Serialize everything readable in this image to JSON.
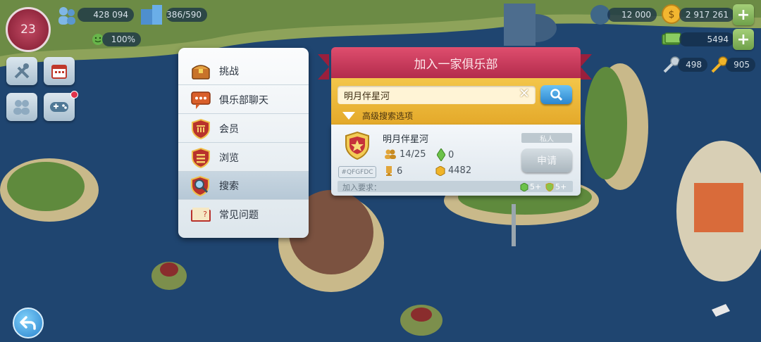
{
  "hud": {
    "level": "23",
    "population": "428 094",
    "capacity": "386/590",
    "happiness": "100%",
    "simoleons_small": "12 000",
    "simoleons": "2 917 261",
    "simcash": "5494",
    "keys_silver": "498",
    "keys_gold": "905"
  },
  "menu": {
    "items": [
      {
        "label": "挑战",
        "icon": "treasure-chest-icon"
      },
      {
        "label": "俱乐部聊天",
        "icon": "chat-bubble-icon"
      },
      {
        "label": "会员",
        "icon": "shield-bank-icon"
      },
      {
        "label": "浏览",
        "icon": "shield-list-icon"
      },
      {
        "label": "搜索",
        "icon": "magnifier-shield-icon"
      },
      {
        "label": "常见问题",
        "icon": "faq-book-icon"
      }
    ]
  },
  "dialog": {
    "title": "加入一家俱乐部",
    "search_value": "明月伴星河",
    "advanced_label": "高级搜索选项",
    "club": {
      "name": "明月伴星河",
      "members": "14/25",
      "energy": "0",
      "rank": "6",
      "points": "4482",
      "id_tag": "#QFGFDC",
      "privacy": "私人",
      "apply_label": "申请",
      "requirements_label": "加入要求：",
      "req_level": "5+",
      "req_other": "5+"
    }
  },
  "colors": {
    "banner": "#c8385a",
    "search_band": "#eeb83a",
    "card": "#e8eef3",
    "menu": "#f2f5f8"
  }
}
